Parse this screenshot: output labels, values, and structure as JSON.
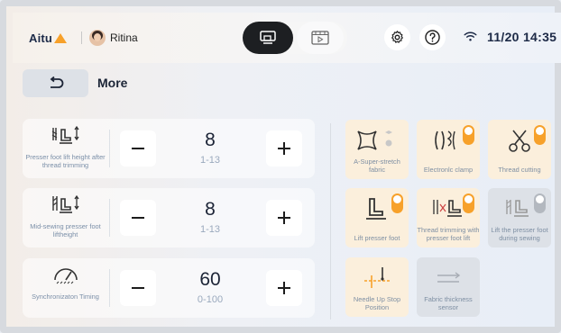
{
  "header": {
    "logo_text": "Aitu",
    "user_name": "Ritina",
    "time": "11/20 14:35",
    "modes": [
      "sewing-machine-mode-icon",
      "video-player-mode-icon"
    ],
    "icons": [
      "settings-gear-icon",
      "help-question-icon",
      "wifi-icon"
    ],
    "accent_color": "#f7a12a"
  },
  "page": {
    "title": "More"
  },
  "controls": [
    {
      "label": "Presser foot lift height after thread trimming",
      "value": "8",
      "range": "1-13"
    },
    {
      "label": "Mid-sewing presser foot liftheight",
      "value": "8",
      "range": "1-13"
    },
    {
      "label": "Synchronizaton Timing",
      "value": "60",
      "range": "0-100"
    }
  ],
  "features": [
    {
      "label": "A-Super-stretch fabric",
      "state": "on",
      "icon": "super-stretch-fabric-icon"
    },
    {
      "label": "Electronlc clamp",
      "state": "on",
      "toggle": "on",
      "icon": "electronic-clamp-icon"
    },
    {
      "label": "Thread cutting",
      "state": "on",
      "toggle": "on",
      "icon": "scissors-icon"
    },
    {
      "label": "Lift presser foot",
      "state": "on",
      "toggle": "on",
      "icon": "presser-foot-icon"
    },
    {
      "label": "Thread trimming with presser foot lift",
      "state": "on",
      "toggle": "on",
      "icon": "trim-lift-icon"
    },
    {
      "label": "Lift the presser foot during sewing",
      "state": "off",
      "toggle": "off",
      "icon": "lift-during-sewing-icon"
    },
    {
      "label": "Needle Up Stop Position",
      "state": "on",
      "icon": "needle-up-stop-icon"
    },
    {
      "label": "Fabric thickness sensor",
      "state": "off",
      "icon": "fabric-thickness-icon"
    }
  ]
}
